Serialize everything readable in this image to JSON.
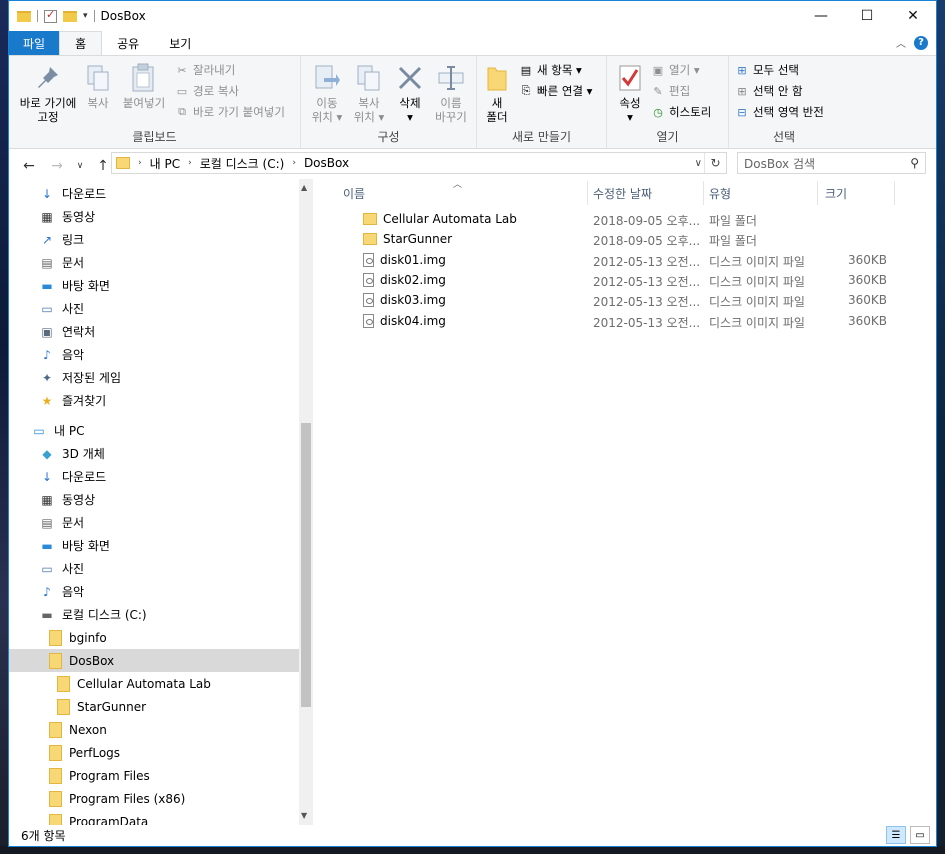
{
  "window": {
    "title": "DosBox",
    "controls": {
      "minimize": "—",
      "maximize": "☐",
      "close": "✕"
    }
  },
  "ribbon": {
    "tabs": [
      "파일",
      "홈",
      "공유",
      "보기"
    ],
    "active_tab": "홈",
    "groups": {
      "clipboard": {
        "label": "클립보드",
        "pin": "바로 가기에\n고정",
        "copy": "복사",
        "paste": "붙여넣기",
        "cut": "잘라내기",
        "copy_path": "경로 복사",
        "paste_shortcut": "바로 가기 붙여넣기"
      },
      "organize": {
        "label": "구성",
        "move_to": "이동\n위치 ▾",
        "copy_to": "복사\n위치 ▾",
        "delete": "삭제\n▾",
        "rename": "이름\n바꾸기"
      },
      "new": {
        "label": "새로 만들기",
        "new_folder": "새\n폴더",
        "new_item": "새 항목 ▾",
        "easy_access": "빠른 연결 ▾"
      },
      "open": {
        "label": "열기",
        "properties": "속성\n▾",
        "open": "열기 ▾",
        "edit": "편집",
        "history": "히스토리"
      },
      "select": {
        "label": "선택",
        "select_all": "모두 선택",
        "select_none": "선택 안 함",
        "invert": "선택 영역 반전"
      }
    }
  },
  "address": {
    "crumbs": [
      "내 PC",
      "로컬 디스크 (C:)",
      "DosBox"
    ],
    "search_placeholder": "DosBox 검색"
  },
  "nav": [
    {
      "label": "다운로드",
      "icon": "download-icon"
    },
    {
      "label": "동영상",
      "icon": "video-icon"
    },
    {
      "label": "링크",
      "icon": "link-icon"
    },
    {
      "label": "문서",
      "icon": "document-icon"
    },
    {
      "label": "바탕 화면",
      "icon": "desktop-icon"
    },
    {
      "label": "사진",
      "icon": "picture-icon"
    },
    {
      "label": "연락처",
      "icon": "contact-icon"
    },
    {
      "label": "음악",
      "icon": "music-icon"
    },
    {
      "label": "저장된 게임",
      "icon": "game-icon"
    },
    {
      "label": "즐겨찾기",
      "icon": "star-icon"
    },
    {
      "label": "내 PC",
      "icon": "pc-icon"
    },
    {
      "label": "3D 개체",
      "icon": "cube-icon"
    },
    {
      "label": "다운로드",
      "icon": "download-icon"
    },
    {
      "label": "동영상",
      "icon": "video-icon"
    },
    {
      "label": "문서",
      "icon": "document-icon"
    },
    {
      "label": "바탕 화면",
      "icon": "desktop-icon"
    },
    {
      "label": "사진",
      "icon": "picture-icon"
    },
    {
      "label": "음악",
      "icon": "music-icon"
    },
    {
      "label": "로컬 디스크 (C:)",
      "icon": "drive-icon"
    },
    {
      "label": "bginfo",
      "icon": "folder-icon"
    },
    {
      "label": "DosBox",
      "icon": "folder-icon"
    },
    {
      "label": "Cellular Automata Lab",
      "icon": "folder-icon"
    },
    {
      "label": "StarGunner",
      "icon": "folder-icon"
    },
    {
      "label": "Nexon",
      "icon": "folder-icon"
    },
    {
      "label": "PerfLogs",
      "icon": "folder-icon"
    },
    {
      "label": "Program Files",
      "icon": "folder-icon"
    },
    {
      "label": "Program Files (x86)",
      "icon": "folder-icon"
    },
    {
      "label": "ProgramData",
      "icon": "folder-icon"
    }
  ],
  "columns": {
    "name": "이름",
    "date": "수정한 날짜",
    "type": "유형",
    "size": "크기"
  },
  "files": [
    {
      "name": "Cellular Automata Lab",
      "date": "2018-09-05 오후...",
      "type": "파일 폴더",
      "size": "",
      "icon": "folder-icon"
    },
    {
      "name": "StarGunner",
      "date": "2018-09-05 오후...",
      "type": "파일 폴더",
      "size": "",
      "icon": "folder-icon"
    },
    {
      "name": "disk01.img",
      "date": "2012-05-13 오전...",
      "type": "디스크 이미지 파일",
      "size": "360KB",
      "icon": "disk-image-icon"
    },
    {
      "name": "disk02.img",
      "date": "2012-05-13 오전...",
      "type": "디스크 이미지 파일",
      "size": "360KB",
      "icon": "disk-image-icon"
    },
    {
      "name": "disk03.img",
      "date": "2012-05-13 오전...",
      "type": "디스크 이미지 파일",
      "size": "360KB",
      "icon": "disk-image-icon"
    },
    {
      "name": "disk04.img",
      "date": "2012-05-13 오전...",
      "type": "디스크 이미지 파일",
      "size": "360KB",
      "icon": "disk-image-icon"
    }
  ],
  "status": {
    "count": "6개 항목"
  },
  "colors": {
    "accent": "#1979ca",
    "selection": "#d9d9d9",
    "folder": "#f8d775"
  }
}
